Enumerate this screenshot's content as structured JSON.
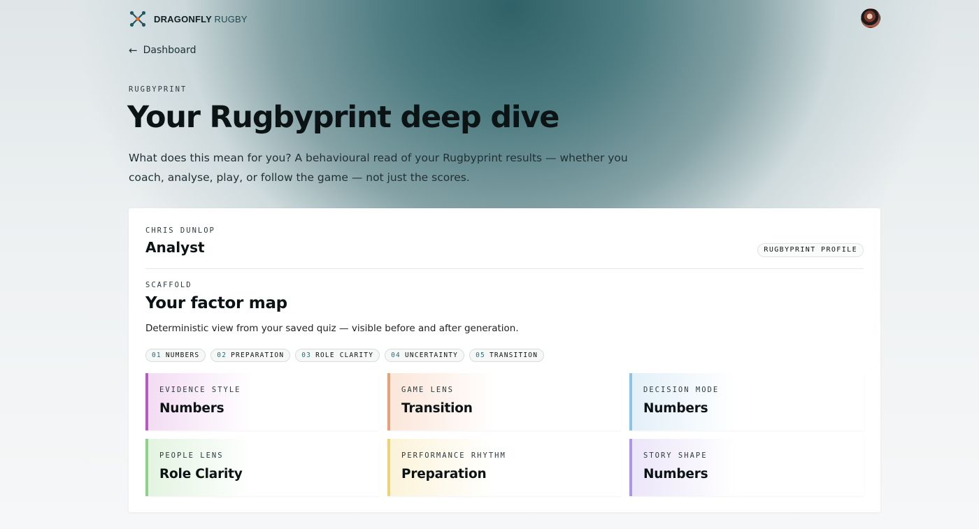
{
  "brand": {
    "name_bold": "DRAGONFLY",
    "name_light": "RUGBY"
  },
  "nav": {
    "back_label": "Dashboard"
  },
  "hero": {
    "eyebrow": "RUGBYPRINT",
    "title": "Your Rugbyprint deep dive",
    "subtitle": "What does this mean for you? A behavioural read of your Rugbyprint results — whether you coach, analyse, play, or follow the game — not just the scores."
  },
  "profile": {
    "owner": "CHRIS DUNLOP",
    "role": "Analyst",
    "badge": "RUGBYPRINT PROFILE"
  },
  "factor_map": {
    "eyebrow": "SCAFFOLD",
    "title": "Your factor map",
    "description": "Deterministic view from your saved quiz — visible before and after generation.",
    "chips": [
      {
        "num": "01",
        "label": "NUMBERS"
      },
      {
        "num": "02",
        "label": "PREPARATION"
      },
      {
        "num": "03",
        "label": "ROLE CLARITY"
      },
      {
        "num": "04",
        "label": "UNCERTAINTY"
      },
      {
        "num": "05",
        "label": "TRANSITION"
      }
    ],
    "tiles": [
      {
        "label": "EVIDENCE STYLE",
        "value": "Numbers",
        "accent": "#b65cc1",
        "tint": "#f3dcf4"
      },
      {
        "label": "GAME LENS",
        "value": "Transition",
        "accent": "#e3a27c",
        "tint": "#fbe6da"
      },
      {
        "label": "DECISION MODE",
        "value": "Numbers",
        "accent": "#8ec3e4",
        "tint": "#e3f0f8"
      },
      {
        "label": "PEOPLE LENS",
        "value": "Role Clarity",
        "accent": "#8fd18c",
        "tint": "#e3f4e1"
      },
      {
        "label": "PERFORMANCE RHYTHM",
        "value": "Preparation",
        "accent": "#ecd37a",
        "tint": "#fbf3d9"
      },
      {
        "label": "STORY SHAPE",
        "value": "Numbers",
        "accent": "#ad96e4",
        "tint": "#ece6f9"
      }
    ]
  },
  "icons": {
    "logo": "dragonfly-logo-icon",
    "back": "arrow-left-icon",
    "avatar": "user-avatar"
  }
}
